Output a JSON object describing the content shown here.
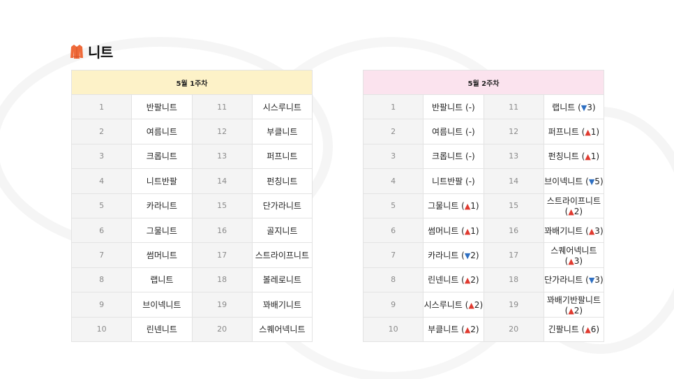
{
  "title": "니트",
  "colors": {
    "up": "#e03a2f",
    "down": "#2e6fc2",
    "header_week1": "#fdf2c8",
    "header_week2": "#fbe3ee",
    "icon": "#ef6a3a"
  },
  "icon": "sweater-icon",
  "week1": {
    "header": "5월 1주차",
    "left": [
      {
        "rank": "1",
        "name": "반팔니트"
      },
      {
        "rank": "2",
        "name": "여름니트"
      },
      {
        "rank": "3",
        "name": "크롭니트"
      },
      {
        "rank": "4",
        "name": "니트반팔"
      },
      {
        "rank": "5",
        "name": "카라니트"
      },
      {
        "rank": "6",
        "name": "그물니트"
      },
      {
        "rank": "7",
        "name": "썸머니트"
      },
      {
        "rank": "8",
        "name": "랩니트"
      },
      {
        "rank": "9",
        "name": "브이넥니트"
      },
      {
        "rank": "10",
        "name": "린넨니트"
      }
    ],
    "right": [
      {
        "rank": "11",
        "name": "시스루니트"
      },
      {
        "rank": "12",
        "name": "부클니트"
      },
      {
        "rank": "13",
        "name": "퍼프니트"
      },
      {
        "rank": "14",
        "name": "펀칭니트"
      },
      {
        "rank": "15",
        "name": "단가라니트"
      },
      {
        "rank": "16",
        "name": "골지니트"
      },
      {
        "rank": "17",
        "name": "스트라이프니트"
      },
      {
        "rank": "18",
        "name": "볼레로니트"
      },
      {
        "rank": "19",
        "name": "꽈배기니트"
      },
      {
        "rank": "20",
        "name": "스퀘어넥니트"
      }
    ]
  },
  "week2": {
    "header": "5월 2주차",
    "left": [
      {
        "rank": "1",
        "name": "반팔니트",
        "dir": "none",
        "change": "-"
      },
      {
        "rank": "2",
        "name": "여름니트",
        "dir": "none",
        "change": "-"
      },
      {
        "rank": "3",
        "name": "크롭니트",
        "dir": "none",
        "change": "-"
      },
      {
        "rank": "4",
        "name": "니트반팔",
        "dir": "none",
        "change": "-"
      },
      {
        "rank": "5",
        "name": "그물니트",
        "dir": "up",
        "change": "1"
      },
      {
        "rank": "6",
        "name": "썸머니트",
        "dir": "up",
        "change": "1"
      },
      {
        "rank": "7",
        "name": "카라니트",
        "dir": "down",
        "change": "2"
      },
      {
        "rank": "8",
        "name": "린넨니트",
        "dir": "up",
        "change": "2"
      },
      {
        "rank": "9",
        "name": "시스루니트",
        "dir": "up",
        "change": "2"
      },
      {
        "rank": "10",
        "name": "부클니트",
        "dir": "up",
        "change": "2"
      }
    ],
    "right": [
      {
        "rank": "11",
        "name": "랩니트",
        "dir": "down",
        "change": "3"
      },
      {
        "rank": "12",
        "name": "퍼프니트",
        "dir": "up",
        "change": "1"
      },
      {
        "rank": "13",
        "name": "펀칭니트",
        "dir": "up",
        "change": "1"
      },
      {
        "rank": "14",
        "name": "브이넥니트",
        "dir": "down",
        "change": "5"
      },
      {
        "rank": "15",
        "name": "스트라이프니트",
        "dir": "up",
        "change": "2"
      },
      {
        "rank": "16",
        "name": "꽈배기니트",
        "dir": "up",
        "change": "3"
      },
      {
        "rank": "17",
        "name": "스퀘어넥니트",
        "dir": "up",
        "change": "3"
      },
      {
        "rank": "18",
        "name": "단가라니트",
        "dir": "down",
        "change": "3"
      },
      {
        "rank": "19",
        "name": "꽈배기반팔니트",
        "dir": "up",
        "change": "2"
      },
      {
        "rank": "20",
        "name": "긴팔니트",
        "dir": "up",
        "change": "6"
      }
    ]
  }
}
